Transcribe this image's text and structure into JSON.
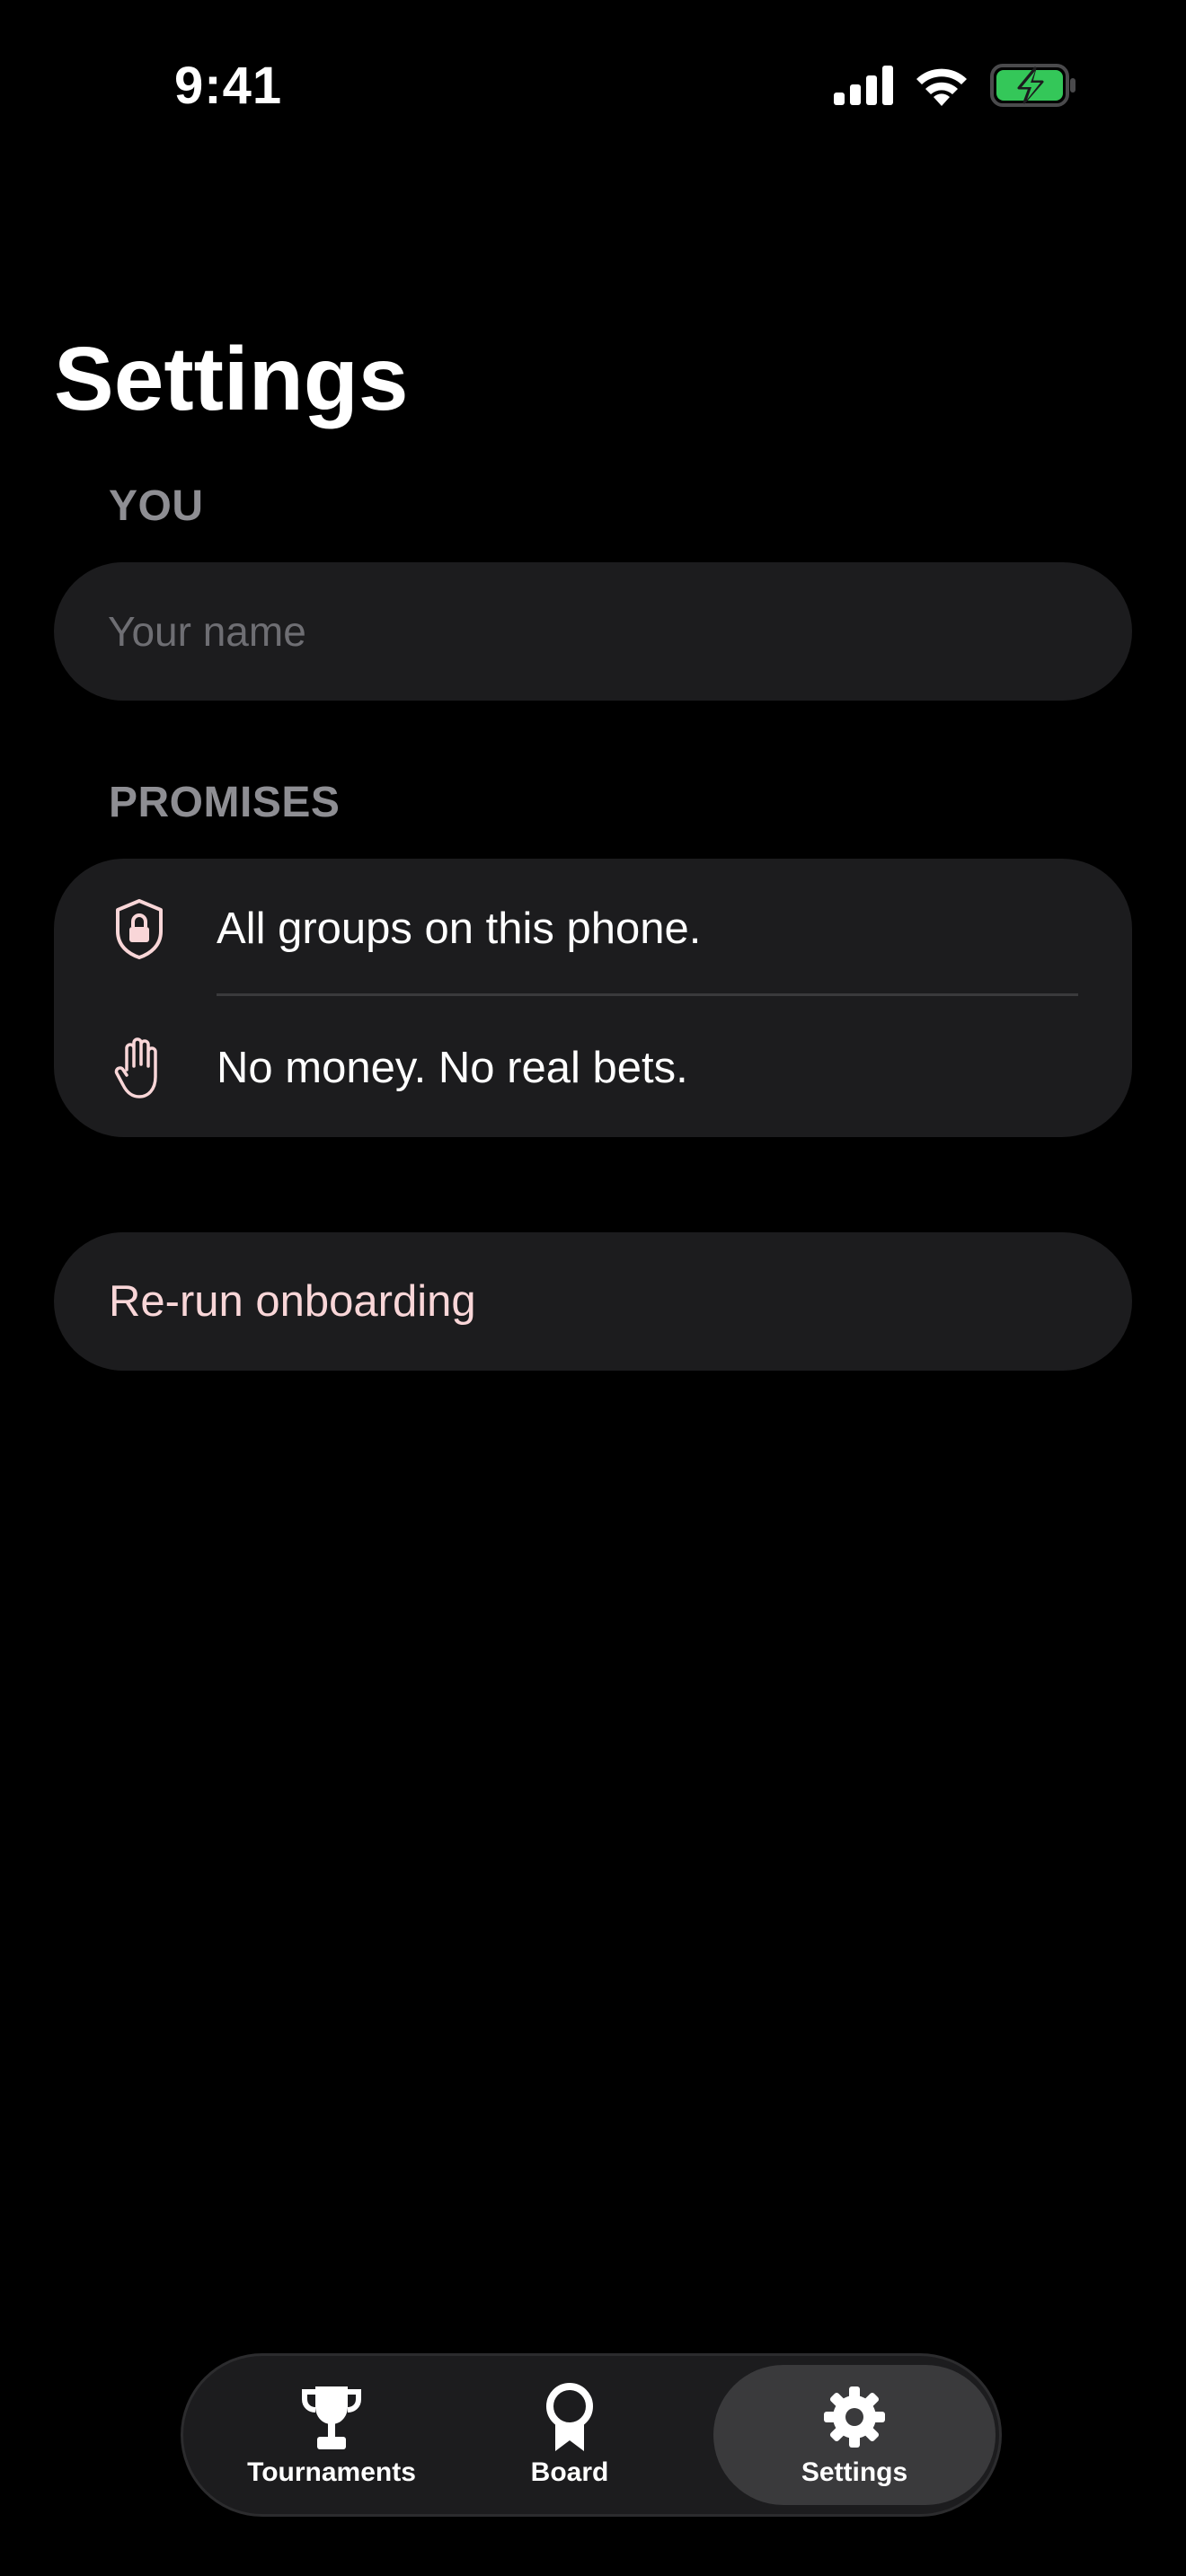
{
  "status_bar": {
    "time": "9:41",
    "icons": [
      "cellular-signal-icon",
      "wifi-icon",
      "battery-charging-icon"
    ]
  },
  "page": {
    "title": "Settings"
  },
  "sections": {
    "you": {
      "header": "YOU",
      "name_input": {
        "value": "",
        "placeholder": "Your name"
      }
    },
    "promises": {
      "header": "PROMISES",
      "items": [
        {
          "icon": "lock-shield-icon",
          "label": "All groups on this phone."
        },
        {
          "icon": "raised-hand-icon",
          "label": "No money. No real bets."
        }
      ]
    },
    "actions": {
      "rerun_onboarding": "Re-run onboarding"
    }
  },
  "tab_bar": {
    "tabs": [
      {
        "icon": "trophy-icon",
        "label": "Tournaments",
        "selected": false
      },
      {
        "icon": "award-ribbon-icon",
        "label": "Board",
        "selected": false
      },
      {
        "icon": "gear-icon",
        "label": "Settings",
        "selected": true
      }
    ]
  },
  "colors": {
    "background": "#000000",
    "card": "#1c1c1e",
    "section_header": "#8e8e93",
    "accent_pink": "#f9d6d8",
    "battery_green": "#34c759",
    "selected_tab": "#3a3a3c"
  }
}
